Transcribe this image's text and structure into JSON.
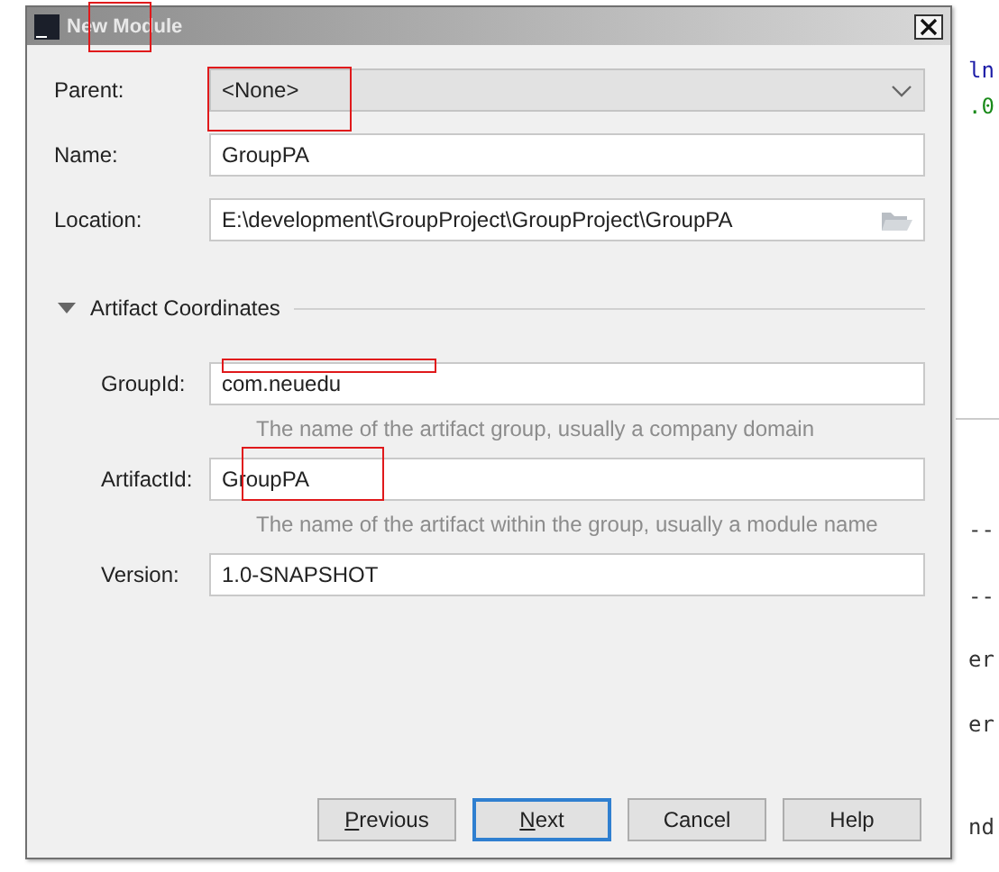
{
  "window": {
    "title": "New Module",
    "annotated": true
  },
  "fields": [
    {
      "label": "Parent:",
      "kind": "combo",
      "value": "<None>",
      "annotated": true
    },
    {
      "label": "Name:",
      "kind": "text",
      "value": "GroupPA",
      "annotated": false
    },
    {
      "label": "Location:",
      "kind": "browse",
      "value": "E:\\development\\GroupProject\\GroupProject\\GroupPA",
      "annotated": false
    }
  ],
  "section": {
    "title": "Artifact Coordinates",
    "expanded": true,
    "fields": [
      {
        "label": "GroupId:",
        "value": "com.neuedu",
        "hint": "The name of the artifact group, usually a company domain",
        "annotated": true
      },
      {
        "label": "ArtifactId:",
        "value": "GroupPA",
        "hint": "The name of the artifact within the group, usually a module name",
        "annotated": true
      },
      {
        "label": "Version:",
        "value": "1.0-SNAPSHOT",
        "annotated": false
      }
    ]
  },
  "buttons": [
    {
      "label": "Previous",
      "mnemonic": true,
      "default": false
    },
    {
      "label": "Next",
      "mnemonic": true,
      "default": true
    },
    {
      "label": "Cancel",
      "mnemonic": false,
      "default": false
    },
    {
      "label": "Help",
      "mnemonic": false,
      "default": false
    }
  ],
  "backdrop": [
    "ln",
    ".0",
    "--",
    "--",
    "er",
    "er",
    "nd"
  ]
}
